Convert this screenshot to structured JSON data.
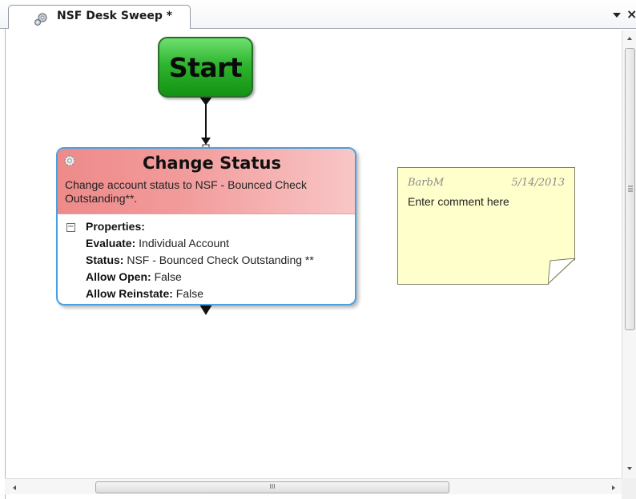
{
  "tab": {
    "title": "NSF Desk Sweep *",
    "icon": "workflow-gears-icon",
    "menu_icon": "chevron-down-icon",
    "close_label": "×"
  },
  "workflow": {
    "start_node": {
      "label": "Start"
    },
    "activity": {
      "title": "Change Status",
      "description": "Change account status to NSF - Bounced Check Outstanding**.",
      "properties_header": "Properties:",
      "properties": [
        {
          "key": "Evaluate:",
          "value": "Individual Account"
        },
        {
          "key": "Status:",
          "value": "NSF - Bounced Check Outstanding **"
        },
        {
          "key": "Allow Open:",
          "value": "False"
        },
        {
          "key": "Allow Reinstate:",
          "value": "False"
        }
      ]
    },
    "comment": {
      "author": "BarbM",
      "date": "5/14/2013",
      "text": "Enter comment here"
    }
  },
  "scrollbar": {
    "grip": "III"
  },
  "colors": {
    "start_node": "#2fb52f",
    "activity_header": "#f29a9a",
    "activity_border": "#4aa0e0",
    "sticky_note": "#ffffcc"
  }
}
